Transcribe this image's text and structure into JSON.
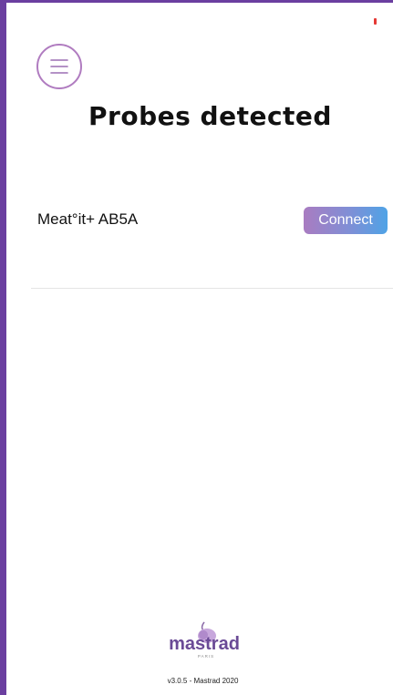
{
  "header": {
    "menu_icon": "hamburger-menu-icon",
    "title": "Probes detected"
  },
  "probes": [
    {
      "name": "Meat°it+ AB5A",
      "action_label": "Connect"
    }
  ],
  "footer": {
    "logo_text": "mastrad",
    "logo_subtext": "PARIS",
    "version": "v3.0.5 - Mastrad 2020"
  },
  "colors": {
    "frame": "#6b3fa0",
    "accent_purple": "#a97cc1",
    "accent_blue": "#4fa3e6",
    "logo_purple": "#6a4a96",
    "status_indicator": "#e53935"
  }
}
